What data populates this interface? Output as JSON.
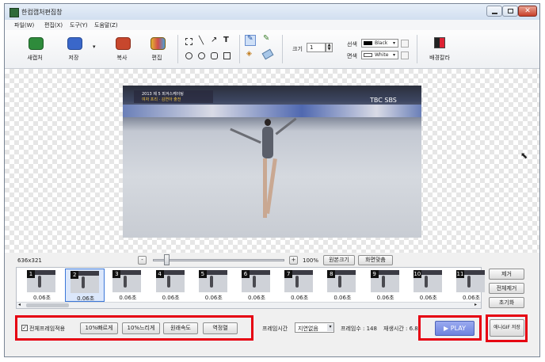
{
  "window": {
    "title": "한컴캡처편집창"
  },
  "menu": [
    "파일(W)",
    "편집(X)",
    "도구(Y)",
    "도움말(Z)"
  ],
  "toolbar": {
    "new_label": "새캡처",
    "save_label": "저장",
    "copy_label": "복사",
    "edit_label": "편집",
    "size_label": "크기",
    "size_value": "1",
    "line_color_label": "선색",
    "line_color_value": "Black",
    "fill_color_label": "면색",
    "fill_color_value": "White",
    "bg_color_label": "배경칼라"
  },
  "canvas": {
    "overlay_logo": "TBC SBS",
    "overlay_caption_top": "2013 제 5 피겨스케이팅",
    "overlay_caption_bottom": "여자 프리 · 김연아 출전"
  },
  "status": {
    "dimensions": "636x321"
  },
  "zoom": {
    "value_label": "100%",
    "original_button": "원본크기",
    "fit_button": "화면맞춤",
    "minus": "-",
    "plus": "+",
    "slider_fraction": 0.11
  },
  "frames": [
    {
      "number": "1",
      "time": "0.06초"
    },
    {
      "number": "2",
      "time": "0.06초"
    },
    {
      "number": "3",
      "time": "0.06초"
    },
    {
      "number": "4",
      "time": "0.06초"
    },
    {
      "number": "5",
      "time": "0.06초"
    },
    {
      "number": "6",
      "time": "0.06초"
    },
    {
      "number": "7",
      "time": "0.06초"
    },
    {
      "number": "8",
      "time": "0.06초"
    },
    {
      "number": "9",
      "time": "0.06초"
    },
    {
      "number": "10",
      "time": "0.06초"
    },
    {
      "number": "11",
      "time": "0.06초"
    }
  ],
  "side_buttons": {
    "remove": "제거",
    "remove_all": "전체제거",
    "reset": "초기화"
  },
  "bottom": {
    "apply_all_label": "전체프레임적용",
    "faster": "10%빠르게",
    "slower": "10%느리게",
    "original_speed": "원래속도",
    "reverse": "역정렬",
    "frame_time_label": "프레임시간",
    "frame_time_value": "지연없음",
    "frame_count": "프레임수 : 148",
    "play_time": "재생시간 : 6.8",
    "play_button": "PLAY",
    "save_gif_button": "애니GIF 저장"
  },
  "colors": {
    "highlight": "#e60012",
    "play_button": "#7b8fe6",
    "selection": "#3b77d8"
  }
}
